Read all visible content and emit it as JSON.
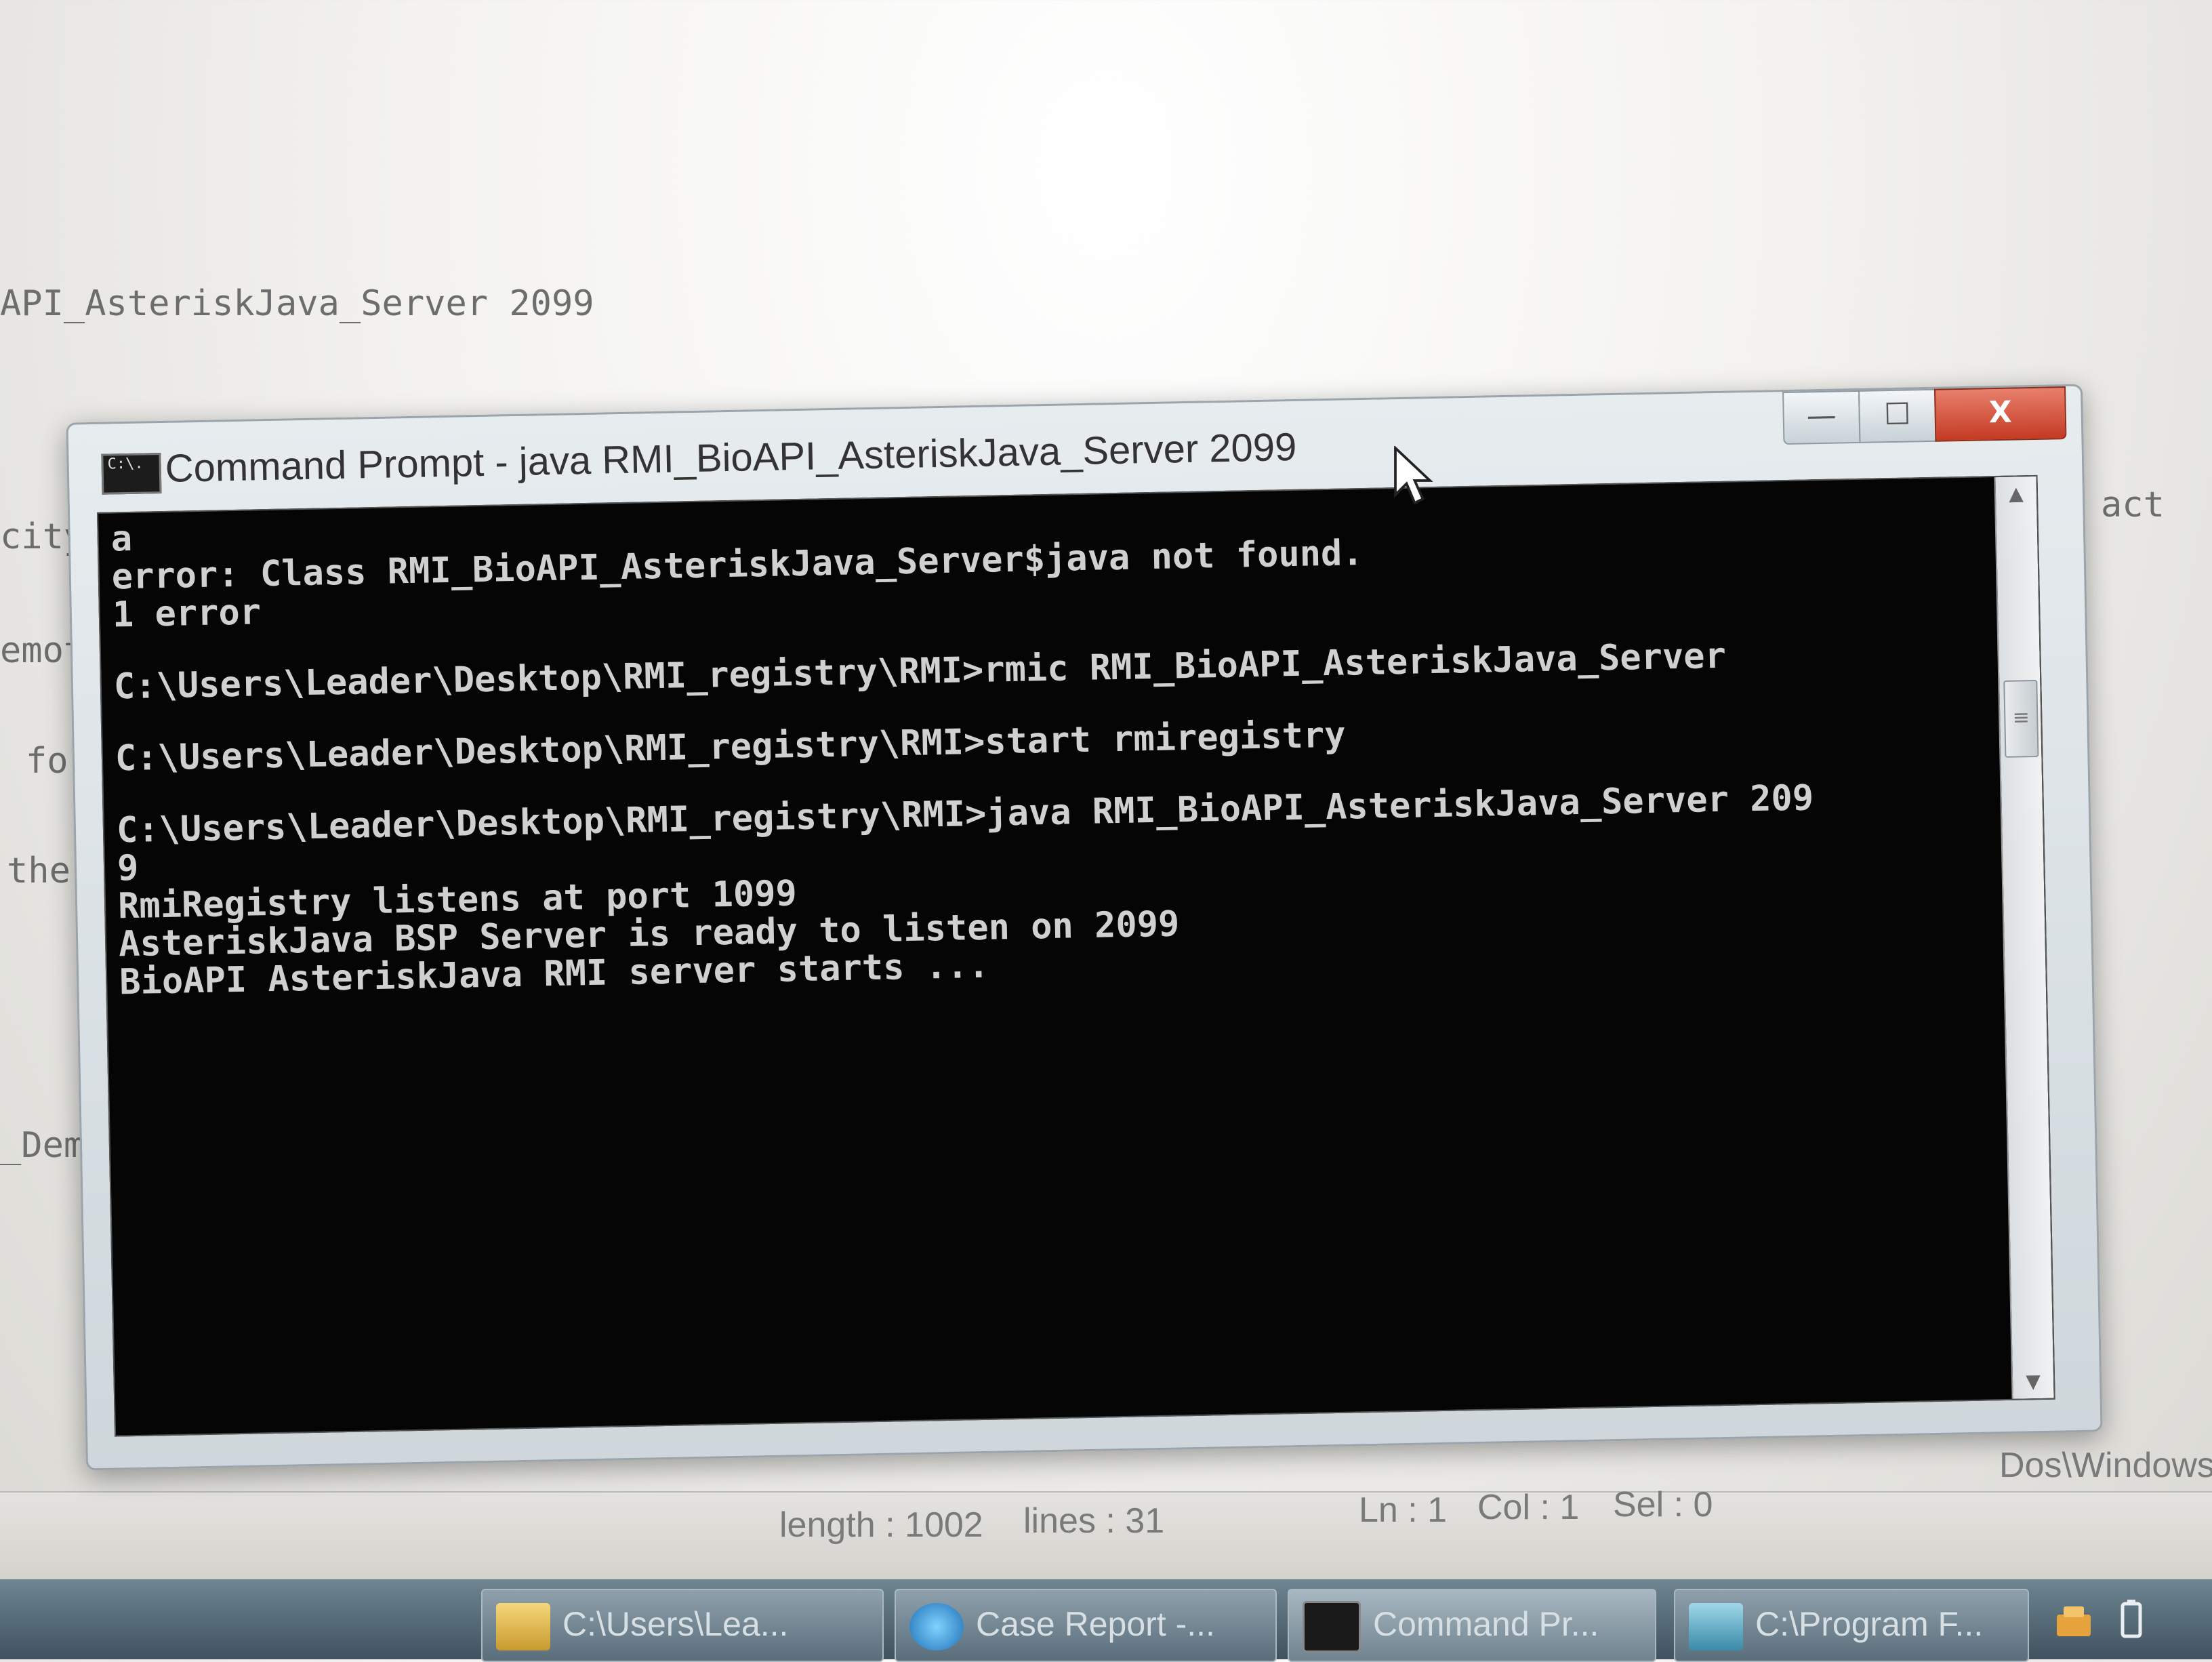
{
  "editor": {
    "lines": [
      "API_AsteriskJava_Server 2099",
      "city",
      "emot",
      "for",
      "the",
      "_Demo",
      "act"
    ]
  },
  "status_bar": {
    "length": "length : 1002",
    "lines": "lines : 31",
    "ln": "Ln : 1",
    "col": "Col : 1",
    "sel": "Sel : 0",
    "mode": "Dos\\Windows"
  },
  "cmd_window": {
    "title": "Command Prompt - java  RMI_BioAPI_AsteriskJava_Server 2099",
    "icon_text": "C:\\.",
    "controls": {
      "minimize": "—",
      "maximize": "☐",
      "close": "X"
    },
    "console_lines": [
      "a",
      "error: Class RMI_BioAPI_AsteriskJava_Server$java not found.",
      "1 error",
      "",
      "C:\\Users\\Leader\\Desktop\\RMI_registry\\RMI>rmic RMI_BioAPI_AsteriskJava_Server",
      "",
      "C:\\Users\\Leader\\Desktop\\RMI_registry\\RMI>start rmiregistry",
      "",
      "C:\\Users\\Leader\\Desktop\\RMI_registry\\RMI>java RMI_BioAPI_AsteriskJava_Server 209",
      "9",
      "RmiRegistry listens at port 1099",
      "AsteriskJava BSP Server is ready to listen on 2099",
      "BioAPI AsteriskJava RMI server starts ..."
    ]
  },
  "taskbar": {
    "buttons": [
      {
        "label": "C:\\Users\\Lea...",
        "icon": "folder-icon"
      },
      {
        "label": "Case Report -...",
        "icon": "internet-explorer-icon"
      },
      {
        "label": "Command Pr...",
        "icon": "command-prompt-icon"
      },
      {
        "label": "C:\\Program F...",
        "icon": "editor-icon"
      }
    ],
    "tray_icons": [
      "network-icon",
      "battery-icon"
    ]
  },
  "colors": {
    "console_bg": "#050505",
    "console_text": "#d0d0d0",
    "close_button": "#c43a22"
  }
}
